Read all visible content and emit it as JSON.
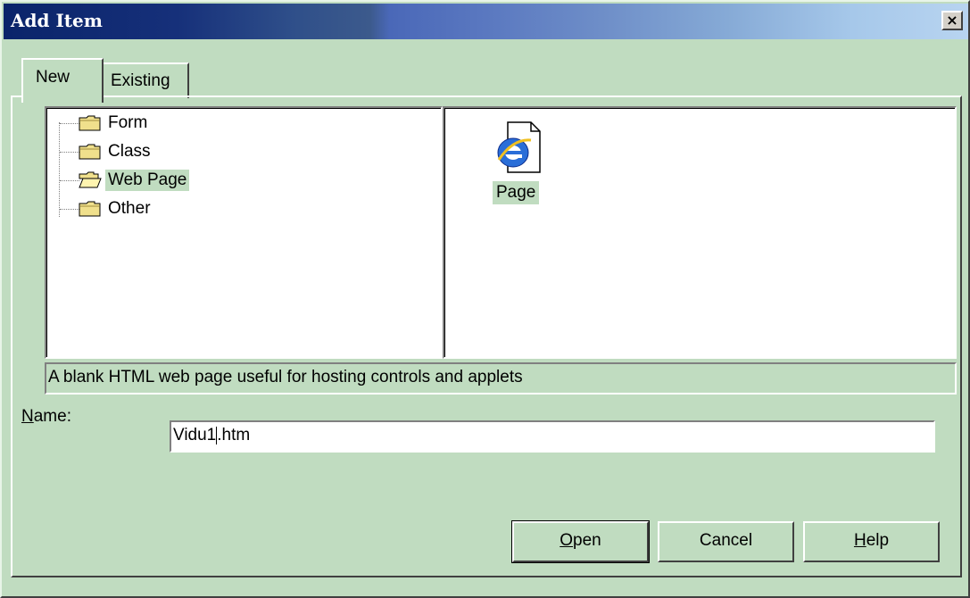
{
  "dialog": {
    "title": "Add Item",
    "close_glyph": "×"
  },
  "tabs": [
    {
      "label": "New",
      "active": true
    },
    {
      "label": "Existing",
      "active": false
    }
  ],
  "tree": {
    "items": [
      {
        "label": "Form",
        "icon": "folder-icon"
      },
      {
        "label": "Class",
        "icon": "folder-icon"
      },
      {
        "label": "Web Page",
        "icon": "folder-open-icon",
        "selected": true
      },
      {
        "label": "Other",
        "icon": "folder-icon"
      }
    ]
  },
  "templates": {
    "items": [
      {
        "label": "Page",
        "icon": "ie-page-icon",
        "selected": true
      }
    ]
  },
  "description": "A blank HTML web page useful for hosting controls and applets",
  "name_field": {
    "label_accel": "N",
    "label_rest": "ame:",
    "value_before_caret": "Vidu1",
    "value_after_caret": ".htm"
  },
  "buttons": {
    "open": {
      "accel": "O",
      "rest": "pen"
    },
    "cancel": {
      "label": "Cancel"
    },
    "help": {
      "accel": "H",
      "rest": "elp"
    }
  },
  "colors": {
    "face": "#c0dcc0",
    "title_start": "#0a246a",
    "title_end": "#a6c8ea",
    "selection": "#c0dcc0"
  }
}
